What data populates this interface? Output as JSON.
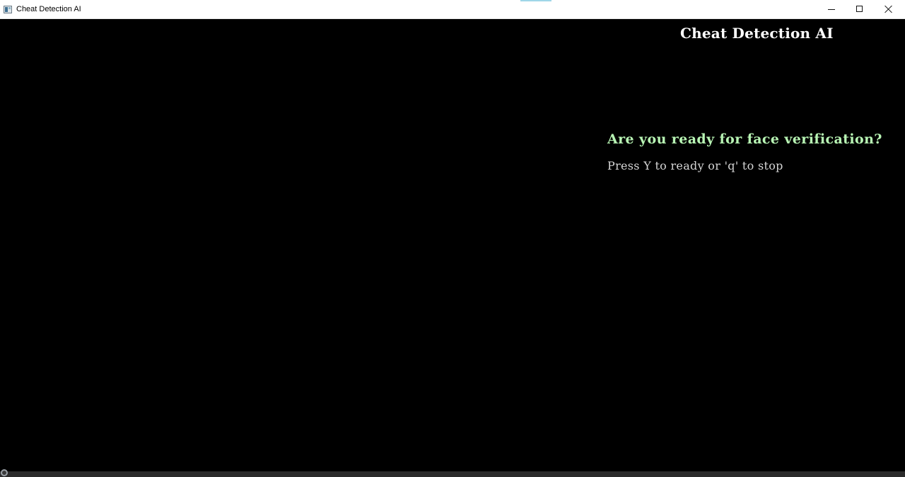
{
  "window": {
    "title": "Cheat Detection AI",
    "icon": "app-window-icon",
    "controls": {
      "minimize_icon": "minimize-icon",
      "maximize_icon": "maximize-icon",
      "close_icon": "close-icon"
    }
  },
  "main": {
    "heading": "Cheat Detection AI",
    "question": "Are you ready for face verification?",
    "hint": "Press Y to ready or 'q' to stop"
  },
  "colors": {
    "background": "#000000",
    "heading": "#ffffff",
    "question": "#b8f5b4",
    "hint": "#d6d6d6"
  }
}
